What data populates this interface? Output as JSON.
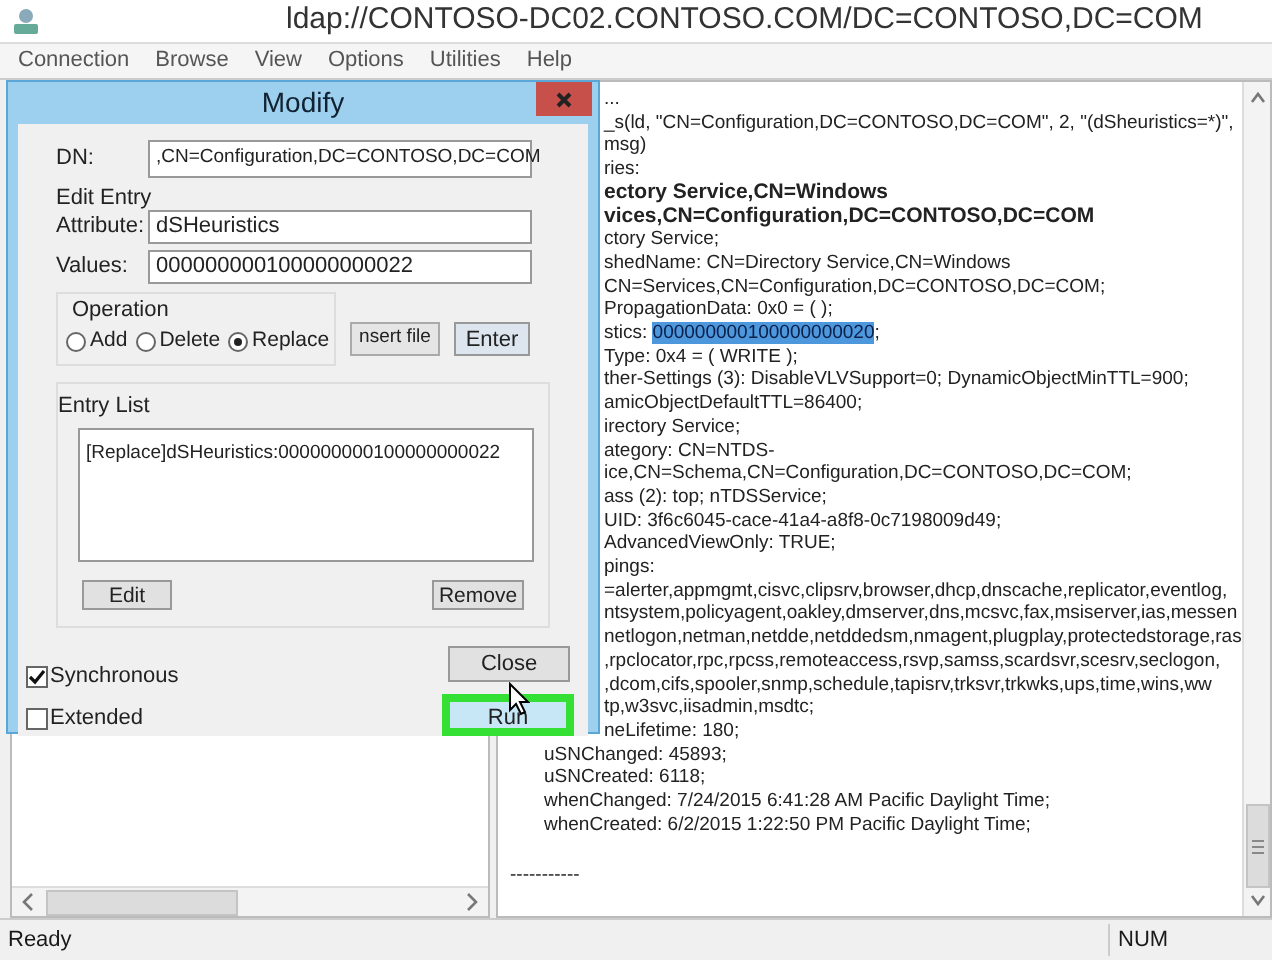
{
  "window": {
    "title": "ldap://CONTOSO-DC02.CONTOSO.COM/DC=CONTOSO,DC=COM"
  },
  "menu": [
    "Connection",
    "Browse",
    "View",
    "Options",
    "Utilities",
    "Help"
  ],
  "output_lines": [
    {
      "bold": false,
      "parts": [
        {
          "text": "...",
          "selected": false
        }
      ]
    },
    {
      "bold": false,
      "parts": [
        {
          "text": "_s(ld, \"CN=Configuration,DC=CONTOSO,DC=COM\", 2, \"(dSheuristics=*)\",",
          "selected": false
        }
      ]
    },
    {
      "bold": false,
      "parts": [
        {
          "text": "msg)",
          "selected": false
        }
      ]
    },
    {
      "bold": false,
      "parts": [
        {
          "text": "ries:",
          "selected": false
        }
      ]
    },
    {
      "bold": true,
      "parts": [
        {
          "text": "ectory Service,CN=Windows",
          "selected": false
        }
      ]
    },
    {
      "bold": true,
      "parts": [
        {
          "text": "vices,CN=Configuration,DC=CONTOSO,DC=COM",
          "selected": false
        }
      ]
    },
    {
      "bold": false,
      "parts": [
        {
          "text": "ctory Service;",
          "selected": false
        }
      ]
    },
    {
      "bold": false,
      "parts": [
        {
          "text": "shedName: CN=Directory Service,CN=Windows",
          "selected": false
        }
      ]
    },
    {
      "bold": false,
      "parts": [
        {
          "text": "CN=Services,CN=Configuration,DC=CONTOSO,DC=COM;",
          "selected": false
        }
      ]
    },
    {
      "bold": false,
      "parts": [
        {
          "text": "PropagationData: 0x0 = (  );",
          "selected": false
        }
      ]
    },
    {
      "bold": false,
      "parts": [
        {
          "text": "stics: ",
          "selected": false
        },
        {
          "text": "000000000100000000020",
          "selected": true
        },
        {
          "text": ";",
          "selected": false
        }
      ]
    },
    {
      "bold": false,
      "parts": [
        {
          "text": "Type: 0x4 = ( WRITE );",
          "selected": false
        }
      ]
    },
    {
      "bold": false,
      "parts": [
        {
          "text": "ther-Settings (3): DisableVLVSupport=0; DynamicObjectMinTTL=900;",
          "selected": false
        }
      ]
    },
    {
      "bold": false,
      "parts": [
        {
          "text": "amicObjectDefaultTTL=86400;",
          "selected": false
        }
      ]
    },
    {
      "bold": false,
      "parts": [
        {
          "text": "irectory Service;",
          "selected": false
        }
      ]
    },
    {
      "bold": false,
      "parts": [
        {
          "text": "ategory: CN=NTDS-",
          "selected": false
        }
      ]
    },
    {
      "bold": false,
      "parts": [
        {
          "text": "ice,CN=Schema,CN=Configuration,DC=CONTOSO,DC=COM;",
          "selected": false
        }
      ]
    },
    {
      "bold": false,
      "parts": [
        {
          "text": "ass (2): top; nTDSService;",
          "selected": false
        }
      ]
    },
    {
      "bold": false,
      "parts": [
        {
          "text": "UID: 3f6c6045-cace-41a4-a8f8-0c7198009d49;",
          "selected": false
        }
      ]
    },
    {
      "bold": false,
      "parts": [
        {
          "text": "AdvancedViewOnly: TRUE;",
          "selected": false
        }
      ]
    },
    {
      "bold": false,
      "parts": [
        {
          "text": "pings:",
          "selected": false
        }
      ]
    },
    {
      "bold": false,
      "parts": [
        {
          "text": "=alerter,appmgmt,cisvc,clipsrv,browser,dhcp,dnscache,replicator,eventlog,",
          "selected": false
        }
      ]
    },
    {
      "bold": false,
      "parts": [
        {
          "text": "ntsystem,policyagent,oakley,dmserver,dns,mcsvc,fax,msiserver,ias,messen",
          "selected": false
        }
      ]
    },
    {
      "bold": false,
      "parts": [
        {
          "text": "netlogon,netman,netdde,netddedsm,nmagent,plugplay,protectedstorage,ras",
          "selected": false
        }
      ]
    },
    {
      "bold": false,
      "parts": [
        {
          "text": ",rpclocator,rpc,rpcss,remoteaccess,rsvp,samss,scardsvr,scesrv,seclogon,",
          "selected": false
        }
      ]
    },
    {
      "bold": false,
      "parts": [
        {
          "text": ",dcom,cifs,spooler,snmp,schedule,tapisrv,trksvr,trkwks,ups,time,wins,ww",
          "selected": false
        }
      ]
    },
    {
      "bold": false,
      "parts": [
        {
          "text": "tp,w3svc,iisadmin,msdtc;",
          "selected": false
        }
      ]
    },
    {
      "bold": false,
      "parts": [
        {
          "text": "neLifetime: 180;",
          "selected": false
        }
      ]
    }
  ],
  "output_lines_below_dialog": [
    {
      "bold": false,
      "parts": [
        {
          "text": "uSNChanged: 45893;",
          "selected": false
        }
      ]
    },
    {
      "bold": false,
      "parts": [
        {
          "text": "uSNCreated: 6118;",
          "selected": false
        }
      ]
    },
    {
      "bold": false,
      "parts": [
        {
          "text": "whenChanged: 7/24/2015 6:41:28 AM Pacific Daylight Time;",
          "selected": false
        }
      ]
    },
    {
      "bold": false,
      "parts": [
        {
          "text": "whenCreated: 6/2/2015 1:22:50 PM Pacific Daylight Time;",
          "selected": false
        }
      ]
    }
  ],
  "separator": "-----------",
  "status_bar": {
    "text": "Ready",
    "indicator": "NUM"
  },
  "dialog": {
    "title": "Modify",
    "dn": {
      "label": "DN:",
      "value": ",CN=Configuration,DC=CONTOSO,DC=COM"
    },
    "edit_entry_label": "Edit Entry",
    "attribute": {
      "label": "Attribute:",
      "value": "dSHeuristics"
    },
    "values": {
      "label": "Values:",
      "value": "000000000100000000022"
    },
    "operation": {
      "label": "Operation",
      "options": [
        {
          "label": "Add",
          "selected": false
        },
        {
          "label": "Delete",
          "selected": false
        },
        {
          "label": "Replace",
          "selected": true
        }
      ]
    },
    "insert_file_button": "nsert file",
    "enter_button": "Enter",
    "entry_list": {
      "label": "Entry List",
      "items": [
        "[Replace]dSHeuristics:000000000100000000022"
      ]
    },
    "edit_button": "Edit",
    "remove_button": "Remove",
    "checkboxes": [
      {
        "label": "Synchronous",
        "checked": true
      },
      {
        "label": "Extended",
        "checked": false
      }
    ],
    "close_button": "Close",
    "run_button": {
      "label": "Run",
      "highlighted": true
    }
  }
}
